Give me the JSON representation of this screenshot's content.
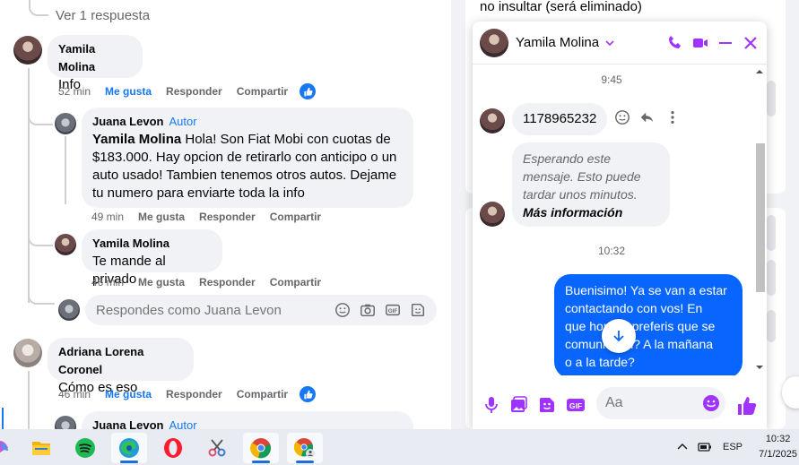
{
  "feed": {
    "view_replies": "Ver 1 respuesta",
    "comments": [
      {
        "author": "Yamila Molina",
        "text": "Info",
        "time": "52 min",
        "like": "Me gusta",
        "reply": "Responder",
        "share": "Compartir",
        "reply_to": {
          "author": "Juana Levon",
          "tag": "Autor",
          "mention": "Yamila Molina",
          "text": " Hola! Son Fiat Mobi con cuotas de $183.000. Hay opcion de retirarlo con anticipo o un auto usado! Tambien tenemos otros autos. Dejame tu numero para enviarte toda la info",
          "time": "49 min",
          "like": "Me gusta",
          "reply": "Responder",
          "share": "Compartir"
        },
        "reply_2": {
          "author": "Yamila Molina",
          "text": "Te mande al privado",
          "time": "46 min",
          "like": "Me gusta",
          "reply": "Responder",
          "share": "Compartir"
        },
        "reply_input_placeholder": "Respondes como Juana Levon"
      },
      {
        "author": "Adriana Lorena Coronel",
        "text": "Cómo es eso",
        "time": "46 min",
        "like": "Me gusta",
        "reply": "Responder",
        "share": "Compartir",
        "next_reply_author": "Juana Levon",
        "next_reply_tag": "Autor"
      }
    ]
  },
  "background": {
    "top_text": "no insultar (será eliminado)"
  },
  "chat": {
    "contact": "Yamila Molina",
    "stamps": [
      "9:45",
      "10:32"
    ],
    "incoming_number": "1178965232",
    "pending": {
      "line1": "Esperando este",
      "line2": "mensaje. Esto puede",
      "line3": "tardar unos minutos.",
      "more": "Más información"
    },
    "outgoing": {
      "line1": "Buenisimo! Ya se van a estar",
      "line2": "contactando con vos! En",
      "line3": "que horario preferis que se",
      "line4": "comuniquen? A la mañana",
      "line5": "o a la tarde?"
    },
    "composer_placeholder": "Aa",
    "accent_color": "#a033ff"
  },
  "taskbar": {
    "language": "ESP",
    "time": "10:32",
    "date": "7/1/2025"
  }
}
